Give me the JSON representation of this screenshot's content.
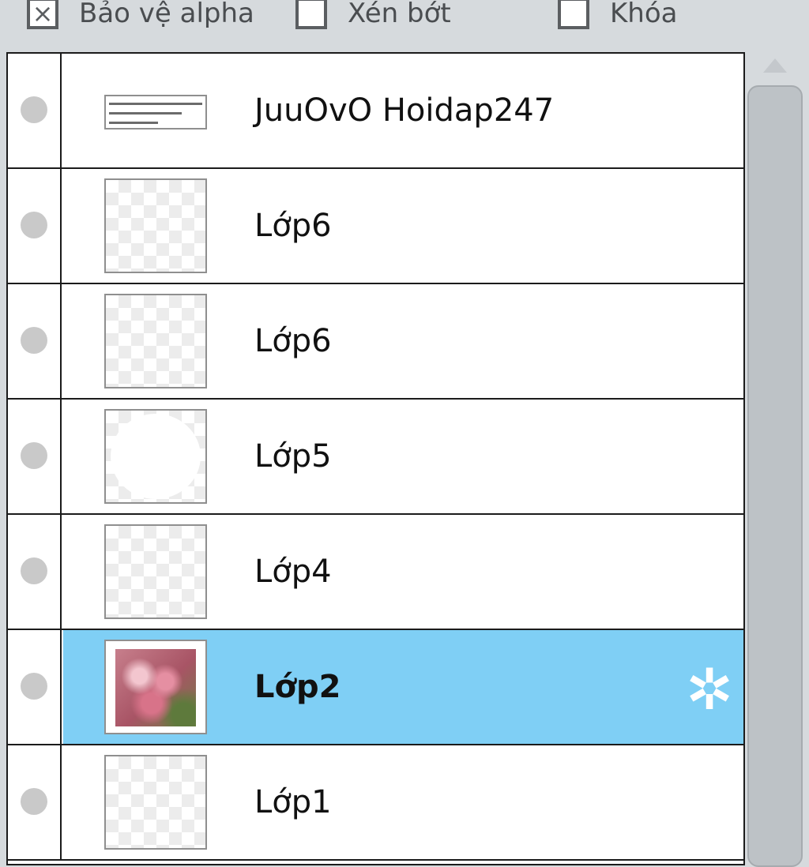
{
  "toolbar": {
    "alpha_protect": {
      "label": "Bảo vệ alpha",
      "checked": true,
      "mark": "×"
    },
    "clip": {
      "label": "Xén bớt",
      "checked": false
    },
    "lock": {
      "label": "Khóa",
      "checked": false
    }
  },
  "layers": [
    {
      "name": "JuuOvO Hoidap247",
      "thumb": "text",
      "selected": false
    },
    {
      "name": "Lớp6",
      "thumb": "transparent",
      "selected": false
    },
    {
      "name": "Lớp6",
      "thumb": "transparent",
      "selected": false
    },
    {
      "name": "Lớp5",
      "thumb": "circle",
      "selected": false
    },
    {
      "name": "Lớp4",
      "thumb": "transparent",
      "selected": false
    },
    {
      "name": "Lớp2",
      "thumb": "photo",
      "selected": true,
      "badge_icon": "gear-icon",
      "badge_glyph": "✲"
    },
    {
      "name": "Lớp1",
      "thumb": "transparent",
      "selected": false
    }
  ],
  "colors": {
    "selected_row": "#7fcff5",
    "panel_bg": "#d6dadd"
  }
}
